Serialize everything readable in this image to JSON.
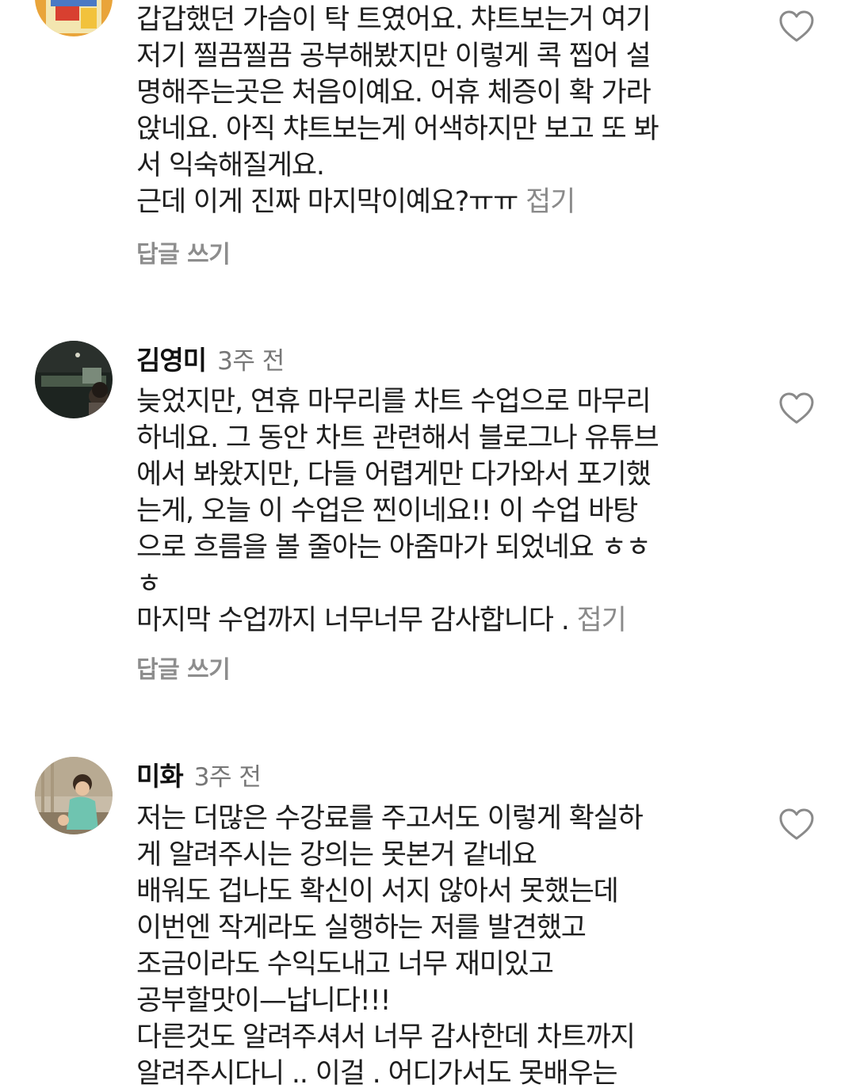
{
  "comments": [
    {
      "author": "",
      "time": "",
      "lines": [
        "갑갑했던 가슴이 탁 트였어요. 챠트보는거 여기",
        "저기 찔끔찔끔  공부해봤지만 이렇게 콕 찝어 설",
        "명해주는곳은 처음이예요. 어휴 체증이 확 가라",
        "앉네요. 아직 챠트보는게 어색하지만 보고 또 봐",
        "서 익숙해질게요.",
        "근데 이게 진짜 마지막이예요?ㅠㅠ"
      ],
      "fold": "접기",
      "reply": "답글 쓰기"
    },
    {
      "author": "김영미",
      "time": "3주 전",
      "lines": [
        "늦었지만, 연휴 마무리를 차트 수업으로 마무리",
        "하네요. 그 동안 차트 관련해서 블로그나 유튜브",
        "에서 봐왔지만, 다들 어렵게만 다가와서 포기했",
        "는게, 오늘 이 수업은 찐이네요!!  이 수업 바탕",
        "으로 흐름을 볼 줄아는 아줌마가 되었네요 ㅎㅎ",
        "ㅎ",
        "마지막 수업까지 너무너무 감사합니다 ."
      ],
      "fold": "접기",
      "reply": "답글 쓰기"
    },
    {
      "author": "미화",
      "time": "3주 전",
      "lines": [
        "저는 더많은 수강료를 주고서도 이렇게 확실하",
        "게 알려주시는 강의는 못본거 같네요",
        "배워도 겁나도 확신이 서지 않아서 못했는데",
        "이번엔 작게라도 실행하는 저를 발견했고",
        "조금이라도 수익도내고 너무 재미있고",
        "공부할맛이—납니다!!!",
        "다른것도 알려주셔서 너무 감사한데 차트까지",
        "알려주시다니 .. 이걸 . 어디가서도 못배우는"
      ]
    }
  ],
  "icons": {
    "like": "heart-outline-icon"
  },
  "colors": {
    "text": "#1e1e1e",
    "muted": "#8a8a8a",
    "icon": "#8a8a8a"
  }
}
